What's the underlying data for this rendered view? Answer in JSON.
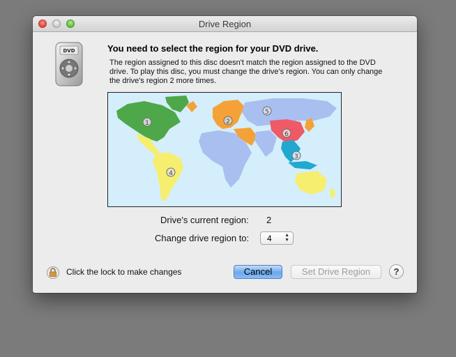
{
  "window": {
    "title": "Drive Region",
    "buttons": [
      "close",
      "minimize",
      "zoom"
    ]
  },
  "dialog": {
    "icon": "dvd-player-icon",
    "headline": "You need to select the region for your DVD drive.",
    "message": "The region assigned to this disc doesn't match the region assigned to the DVD drive. To play this disc, you must change the drive's region. You can only change the drive's region 2 more times.",
    "map": {
      "regions": [
        {
          "number": "1",
          "color": "#4ea84a"
        },
        {
          "number": "2",
          "color": "#f4a238"
        },
        {
          "number": "3",
          "color": "#20a8d0"
        },
        {
          "number": "4",
          "color": "#f6ee6e"
        },
        {
          "number": "5",
          "color": "#a9bff0"
        },
        {
          "number": "6",
          "color": "#ee5a66"
        }
      ]
    },
    "current_region_label": "Drive's current region:",
    "current_region_value": "2",
    "change_region_label": "Change drive region to:",
    "change_region_selected": "4",
    "lock_icon": "lock-icon",
    "lock_label": "Click the lock to make changes",
    "cancel_label": "Cancel",
    "set_label": "Set Drive Region",
    "help_label": "?"
  }
}
